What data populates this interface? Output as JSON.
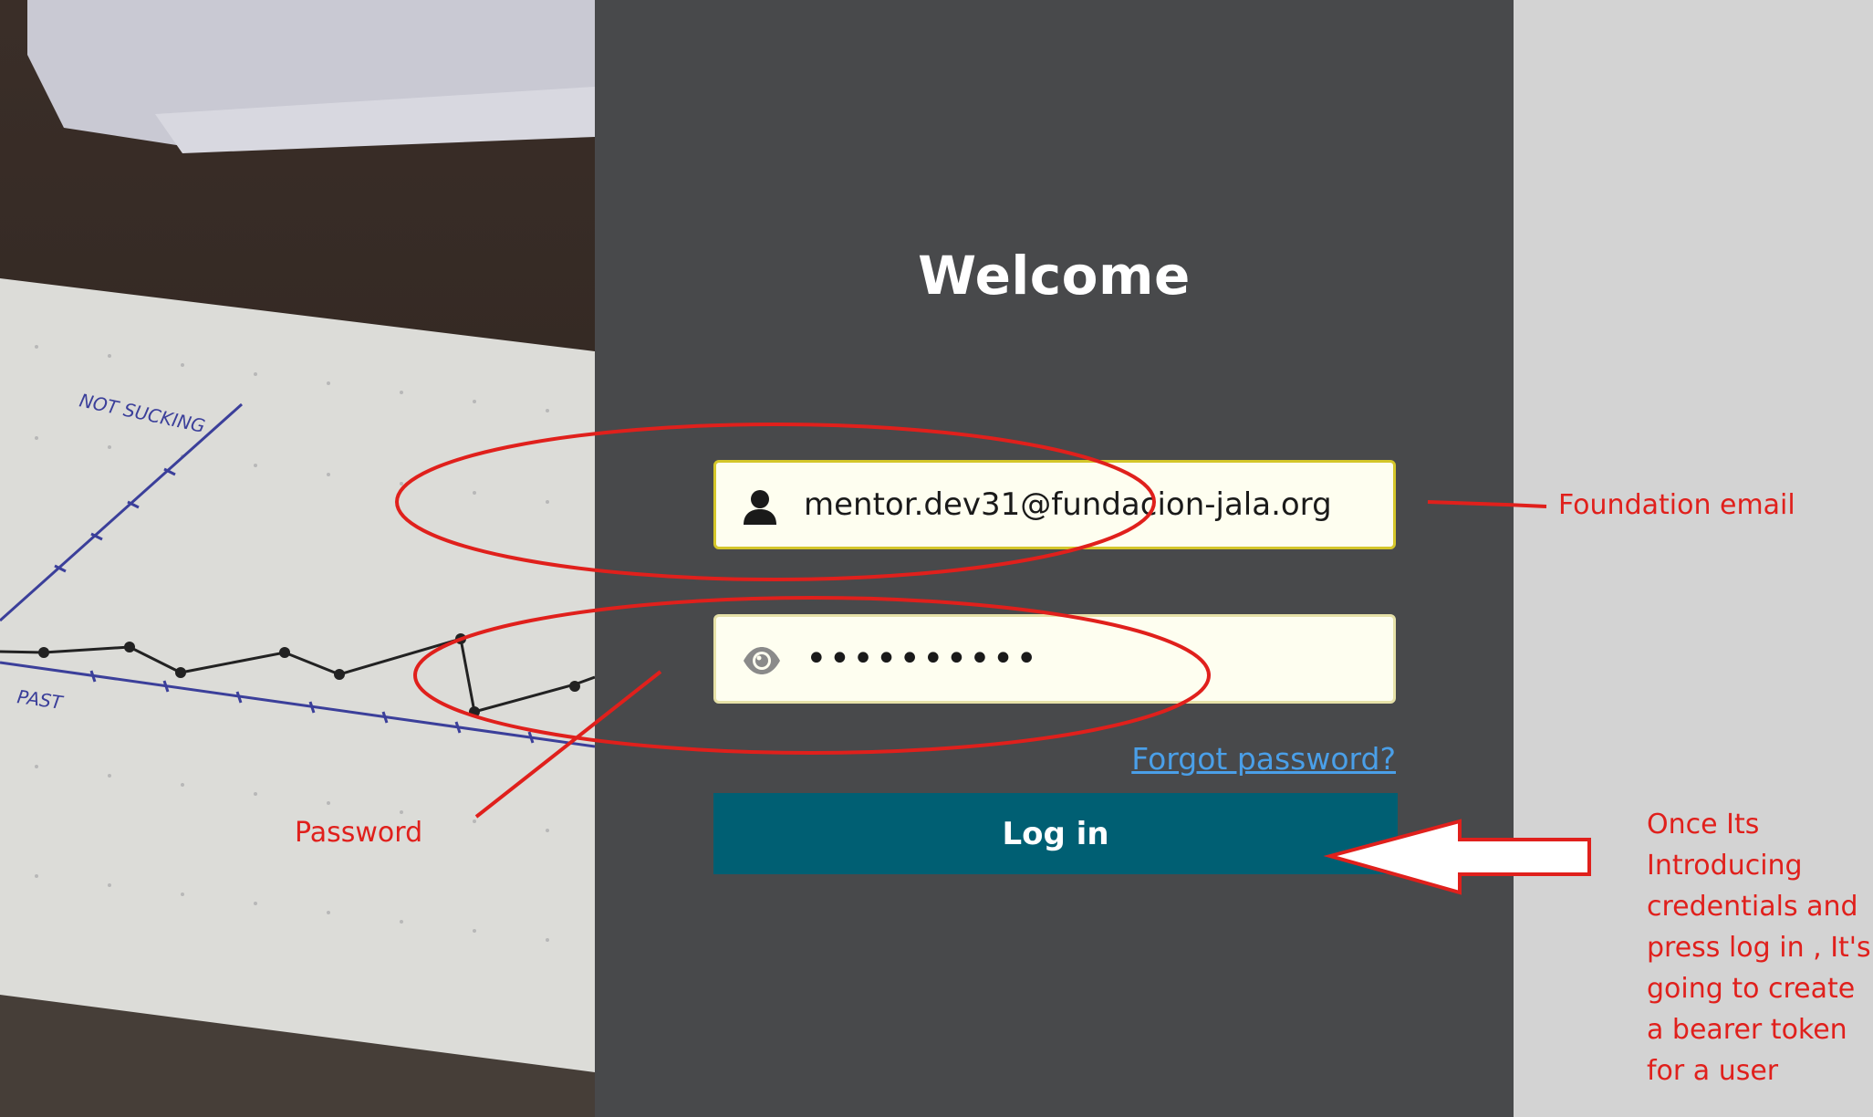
{
  "login": {
    "title": "Welcome",
    "email_value": "mentor.dev31@fundacion-jala.org",
    "password_value": "••••••••••",
    "forgot_link": "Forgot password?",
    "login_button": "Log in"
  },
  "background_photo": {
    "axis_label_top": "NOT SUCKING",
    "axis_label_bottom": "PAST"
  },
  "annotations": {
    "email_label": "Foundation email",
    "password_label": "Password",
    "note_lines": [
      "Once Its",
      "Introducing",
      "credentials and",
      "press log in , It's",
      "going to create",
      "a bearer token",
      "for a user"
    ]
  },
  "icons": {
    "email_field_icon": "user-icon",
    "password_field_icon": "eye-icon"
  },
  "colors": {
    "panel_background": "#48494b",
    "button_background": "#005f73",
    "link_color": "#4a9fe8",
    "annotation_color": "#e0201c",
    "field_background": "#fefef0",
    "email_field_border": "#d4c62a"
  }
}
